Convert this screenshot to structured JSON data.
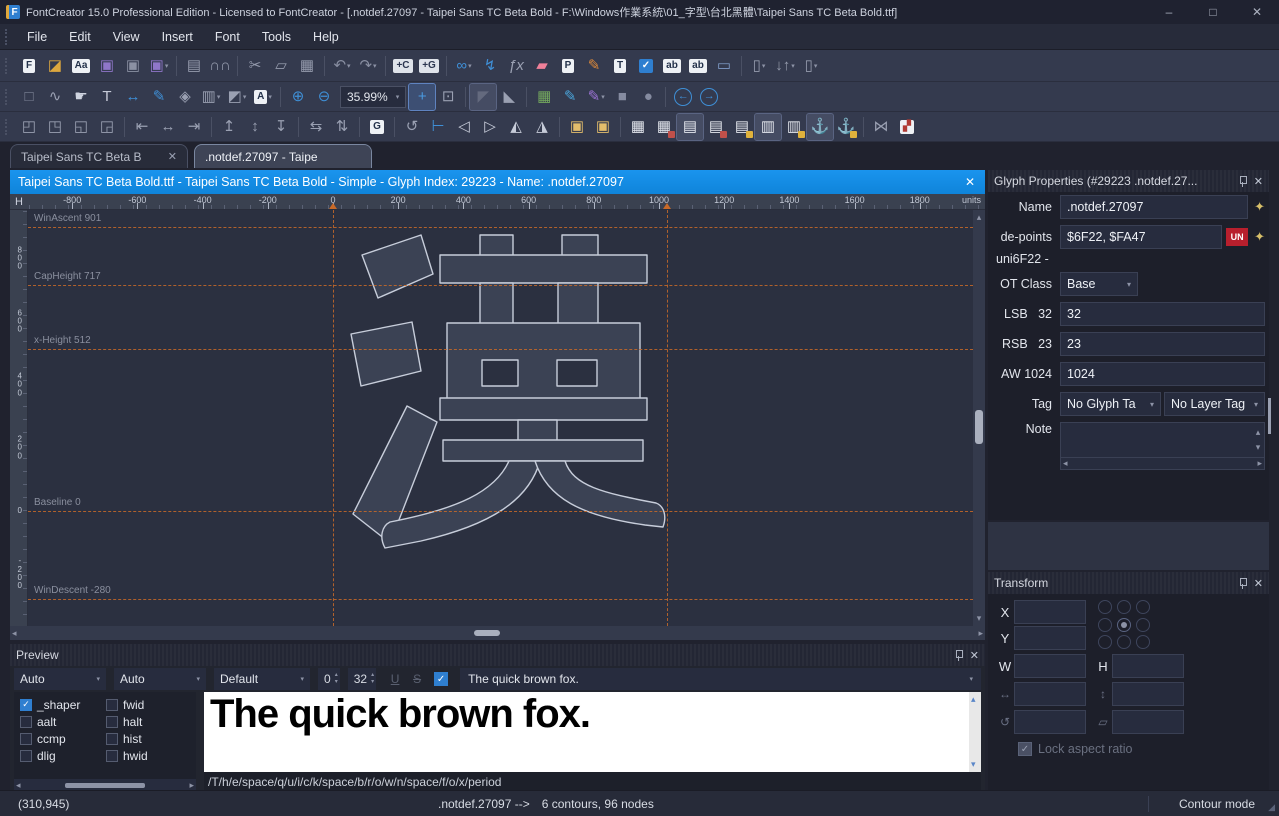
{
  "window": {
    "title": "FontCreator 15.0 Professional Edition - Licensed to FontCreator - [.notdef.27097 - Taipei Sans TC Beta Bold - F:\\Windows作業系統\\01_字型\\台北黑體\\Taipei Sans TC Beta Bold.ttf]",
    "app_initial": "F",
    "minimize": "–",
    "maximize": "□",
    "close": "✕"
  },
  "menu": {
    "items": [
      "File",
      "Edit",
      "View",
      "Insert",
      "Font",
      "Tools",
      "Help"
    ]
  },
  "toolbars": {
    "rows": [
      [
        {
          "n": "new-font",
          "g": "F",
          "chip": "#eef1f5",
          "c": "#23314a"
        },
        {
          "n": "open-font",
          "g": "◪",
          "c": "#dca73e"
        },
        {
          "n": "font-overview",
          "g": "Aa",
          "chip": "#eef1f5",
          "c": "#23314a"
        },
        {
          "n": "save-font",
          "g": "▣",
          "c": "#8f76c9"
        },
        {
          "n": "save-all",
          "g": "▣",
          "c": "#8b91a3"
        },
        {
          "n": "save-as",
          "g": "▣",
          "c": "#8f76c9",
          "dd": true
        },
        {
          "n": "print",
          "g": "▤",
          "c": "#959bad",
          "sep": true
        },
        {
          "n": "find",
          "g": "∩∩",
          "c": "#959bad"
        },
        {
          "n": "cut",
          "g": "✂",
          "c": "#959bad",
          "sep": true
        },
        {
          "n": "copy",
          "g": "▱",
          "c": "#959bad"
        },
        {
          "n": "paste",
          "g": "▦",
          "c": "#959bad"
        },
        {
          "n": "undo",
          "g": "↶",
          "c": "#878da0",
          "sep": true,
          "dd": true
        },
        {
          "n": "redo",
          "g": "↷",
          "c": "#878da0",
          "dd": true
        },
        {
          "n": "add-character",
          "g": "+C",
          "chip": "#dfe3ea",
          "c": "#2c3650",
          "sep": true
        },
        {
          "n": "add-glyph",
          "g": "+G",
          "chip": "#dfe3ea",
          "c": "#2c3650"
        },
        {
          "n": "insert-link",
          "g": "∞",
          "c": "#3f8fd6",
          "sep": true,
          "dd": true
        },
        {
          "n": "remove-link",
          "g": "↯",
          "c": "#3f8fd6"
        },
        {
          "n": "function",
          "g": "ƒx",
          "c": "#9aa0b2",
          "it": true
        },
        {
          "n": "eraser",
          "g": "▰",
          "c": "#ef8099"
        },
        {
          "n": "font-properties",
          "g": "P",
          "chip": "#eef1f5",
          "c": "#23314a"
        },
        {
          "n": "edit-metrics",
          "g": "✎",
          "c": "#df8a3a"
        },
        {
          "n": "auto-metrics",
          "g": "T",
          "chip": "#eef1f5",
          "c": "#23314a"
        },
        {
          "n": "validate",
          "g": "✓",
          "chip": "#2f7fd0",
          "c": "#ffffff"
        },
        {
          "n": "find-text",
          "g": "ab",
          "chip": "#eef1f5",
          "c": "#23314a"
        },
        {
          "n": "web-test",
          "g": "ab",
          "chip": "#eef1f5",
          "c": "#23314a"
        },
        {
          "n": "quick-test",
          "g": "▭",
          "c": "#7f9bc8"
        },
        {
          "n": "new-window",
          "g": "▯",
          "c": "#959bad",
          "sep": true,
          "dd": true
        },
        {
          "n": "sort-glyphs",
          "g": "↓↑",
          "c": "#959bad",
          "dd": true
        },
        {
          "n": "import-glyphs",
          "g": "▯",
          "c": "#959bad",
          "dd": true
        }
      ],
      [
        {
          "n": "select-tool",
          "g": "□",
          "c": "#7e8498"
        },
        {
          "n": "contour-select-tool",
          "g": "∿",
          "c": "#9aa0b2"
        },
        {
          "n": "hand-tool",
          "g": "☛",
          "c": "#cfd4e0"
        },
        {
          "n": "text-tool",
          "g": "T",
          "c": "#c6cbd8"
        },
        {
          "n": "measure-tool",
          "g": "↔",
          "c": "#3f8fd6"
        },
        {
          "n": "draw-tool",
          "g": "✎",
          "c": "#3f8fd6"
        },
        {
          "n": "knife-tool",
          "g": "◈",
          "c": "#9aa0b2"
        },
        {
          "n": "background-image",
          "g": "▥",
          "c": "#9aa0b2",
          "dd": true
        },
        {
          "n": "fill-mode",
          "g": "◩",
          "c": "#9aa0b2",
          "dd": true
        },
        {
          "n": "highlight-mode",
          "g": "A",
          "chip": "#eef1f5",
          "c": "#23314a",
          "dd": true
        },
        {
          "n": "zoom-in",
          "g": "⊕",
          "c": "#3f8fd6",
          "sep": true
        },
        {
          "n": "zoom-out",
          "g": "⊖",
          "c": "#3f8fd6"
        },
        {
          "type": "combo",
          "n": "zoom-level",
          "v": "35.99%"
        },
        {
          "n": "pan-tool",
          "g": "+",
          "c": "#4a9ae0",
          "act": true
        },
        {
          "n": "zoom-window",
          "g": "⊡",
          "c": "#9aa0b2"
        },
        {
          "n": "fill-preview",
          "g": "◤",
          "c": "#646a7e",
          "press": true,
          "sep": true
        },
        {
          "n": "node-edit",
          "g": "◣",
          "c": "#9aa0b2"
        },
        {
          "n": "insert-image",
          "g": "▦",
          "c": "#74a85e",
          "sep": true
        },
        {
          "n": "brush-tool",
          "g": "✎",
          "c": "#4aa3d9"
        },
        {
          "n": "calligraphy-tool",
          "g": "✎",
          "c": "#9d74d6",
          "dd": true
        },
        {
          "n": "rectangle-tool",
          "g": "■",
          "c": "#858ba0"
        },
        {
          "n": "ellipse-tool",
          "g": "●",
          "c": "#858ba0"
        },
        {
          "n": "nav-back",
          "g": "←",
          "c": "#3f8fd6",
          "ring": true,
          "sep": true
        },
        {
          "n": "nav-forward",
          "g": "→",
          "c": "#3f8fd6",
          "ring": true
        }
      ],
      [
        {
          "n": "align-left",
          "g": "◰",
          "c": "#9aa0b2"
        },
        {
          "n": "align-center-horizontal",
          "g": "◳",
          "c": "#9aa0b2"
        },
        {
          "n": "align-right",
          "g": "◱",
          "c": "#9aa0b2"
        },
        {
          "n": "align-points",
          "g": "◲",
          "c": "#9aa0b2"
        },
        {
          "n": "distribute-left",
          "g": "⇤",
          "c": "#9aa0b2",
          "sep": true
        },
        {
          "n": "distribute-center",
          "g": "↔",
          "c": "#9aa0b2"
        },
        {
          "n": "distribute-right",
          "g": "⇥",
          "c": "#9aa0b2"
        },
        {
          "n": "align-top",
          "g": "↥",
          "c": "#9aa0b2",
          "sep": true
        },
        {
          "n": "align-middle",
          "g": "↕",
          "c": "#9aa0b2"
        },
        {
          "n": "align-bottom",
          "g": "↧",
          "c": "#9aa0b2"
        },
        {
          "n": "center-horizontal",
          "g": "⇆",
          "c": "#9aa0b2",
          "sep": true
        },
        {
          "n": "center-vertical",
          "g": "⇅",
          "c": "#9aa0b2"
        },
        {
          "n": "glyph-metrics-link",
          "g": "G",
          "chip": "#eef1f5",
          "c": "#23314a",
          "sep": true
        },
        {
          "n": "free-rotate",
          "g": "↺",
          "c": "#9aa0b2",
          "sep": true
        },
        {
          "n": "slant-tool",
          "g": "⊢",
          "c": "#3f8fd6"
        },
        {
          "n": "flip-horizontal",
          "g": "◁",
          "c": "#c6cbd8"
        },
        {
          "n": "flip-vertical",
          "g": "▷",
          "c": "#c6cbd8"
        },
        {
          "n": "rotate-ccw",
          "g": "◭",
          "c": "#c6cbd8"
        },
        {
          "n": "rotate-cw",
          "g": "◮",
          "c": "#c6cbd8"
        },
        {
          "n": "order-forward",
          "g": "▣",
          "c": "#e3bd6b",
          "sep": true
        },
        {
          "n": "order-backward",
          "g": "▣",
          "c": "#e3bd6b"
        },
        {
          "n": "grid-all",
          "g": "▦",
          "c": "#e4e7ee",
          "sep": true
        },
        {
          "n": "grid-reset",
          "g": "▦",
          "c": "#e4e7ee",
          "badge": "#c0504a"
        },
        {
          "n": "grid-rows",
          "g": "▤",
          "c": "#e4e7ee",
          "press": true
        },
        {
          "n": "grid-rows-reset",
          "g": "▤",
          "c": "#e4e7ee",
          "badge": "#c0504a"
        },
        {
          "n": "grid-lock-rows",
          "g": "▤",
          "c": "#e4e7ee",
          "badge": "#e0b23c"
        },
        {
          "n": "grid-columns",
          "g": "▥",
          "c": "#e4e7ee",
          "press": true
        },
        {
          "n": "grid-lock-columns",
          "g": "▥",
          "c": "#e4e7ee",
          "badge": "#e0b23c"
        },
        {
          "n": "anchor",
          "g": "⚓",
          "c": "#4a9ae0",
          "press": true
        },
        {
          "n": "anchor-lock",
          "g": "⚓",
          "c": "#4a9ae0",
          "badge": "#e0b23c"
        },
        {
          "n": "composite-relations",
          "g": "⋈",
          "c": "#9aa0b2",
          "sep": true
        },
        {
          "n": "composite-data",
          "g": "▞",
          "chip": "#eef1f5",
          "c": "#b03a34"
        }
      ]
    ]
  },
  "tabs": [
    {
      "label": "Taipei Sans TC Beta B",
      "active": false
    },
    {
      "label": ".notdef.27097 - Taipe",
      "active": true
    }
  ],
  "editor": {
    "header": {
      "title": "Taipei Sans TC Beta Bold.ttf - Taipei Sans TC Beta Bold - Simple - Glyph Index: 29223 - Name: .notdef.27097",
      "close": "✕"
    },
    "ruler": {
      "h_label": "H",
      "units_label": "units",
      "top_ticks": [
        {
          "t": "-800",
          "u": -800
        },
        {
          "t": "-600",
          "u": -600
        },
        {
          "t": "-400",
          "u": -400
        },
        {
          "t": "-200",
          "u": -200
        },
        {
          "t": "0",
          "u": 0
        },
        {
          "t": "200",
          "u": 200
        },
        {
          "t": "400",
          "u": 400
        },
        {
          "t": "600",
          "u": 600
        },
        {
          "t": "800",
          "u": 800
        },
        {
          "t": "1000",
          "u": 1000
        },
        {
          "t": "1200",
          "u": 1200
        },
        {
          "t": "1400",
          "u": 1400
        },
        {
          "t": "1600",
          "u": 1600
        },
        {
          "t": "1800",
          "u": 1800
        }
      ],
      "markers": [
        0,
        1024
      ],
      "v_ticks": [
        {
          "t": "800",
          "u": 800
        },
        {
          "t": "600",
          "u": 600
        },
        {
          "t": "400",
          "u": 400
        },
        {
          "t": "200",
          "u": 200
        },
        {
          "t": "0",
          "u": 0
        },
        {
          "t": "-200",
          "u": -200
        }
      ]
    },
    "guides": [
      {
        "label": "WinAscent 901",
        "u": 901
      },
      {
        "label": "CapHeight 717",
        "u": 717
      },
      {
        "label": "x-Height 512",
        "u": 512
      },
      {
        "label": "Baseline 0",
        "u": 0
      },
      {
        "label": "WinDescent -280",
        "u": -280
      }
    ],
    "v_guides": [
      0,
      1024
    ],
    "glyph_char": "漢"
  },
  "glyph_properties": {
    "title": "Glyph Properties (#29223 .notdef.27...",
    "name_label": "Name",
    "name_value": ".notdef.27097",
    "codepoints_label": "de-points",
    "codepoints_value": "$6F22, $FA47",
    "unicode_badge": "UN",
    "unicode_info": "uni6F22 -",
    "ot_class_label": "OT Class",
    "ot_class_value": "Base",
    "lsb_label": "LSB",
    "lsb_static": "32",
    "lsb_value": "32",
    "rsb_label": "RSB",
    "rsb_static": "23",
    "rsb_value": "23",
    "aw_label": "AW",
    "aw_static": "1024",
    "aw_value": "1024",
    "tag_label": "Tag",
    "glyph_tag_value": "No Glyph Ta",
    "layer_tag_value": "No Layer Tag",
    "note_label": "Note"
  },
  "transform": {
    "title": "Transform",
    "x_label": "X",
    "y_label": "Y",
    "w_label": "W",
    "h_label": "H",
    "lock_label": "Lock aspect ratio"
  },
  "preview": {
    "title": "Preview",
    "script_value": "Auto",
    "language_value": "Auto",
    "feature_set_value": "Default",
    "tracking_value": "0",
    "size_value": "32",
    "underline_label": "U",
    "strike_label": "S",
    "sample_text": "The quick brown fox.",
    "glyph_sequence": "/T/h/e/space/q/u/i/c/k/space/b/r/o/w/n/space/f/o/x/period",
    "features_col1": [
      {
        "label": "_shaper",
        "checked": true
      },
      {
        "label": "aalt",
        "checked": false
      },
      {
        "label": "ccmp",
        "checked": false
      },
      {
        "label": "dlig",
        "checked": false
      }
    ],
    "features_col2": [
      {
        "label": "fwid",
        "checked": false
      },
      {
        "label": "halt",
        "checked": false
      },
      {
        "label": "hist",
        "checked": false
      },
      {
        "label": "hwid",
        "checked": false
      }
    ]
  },
  "status": {
    "coordinates": "(310,945)",
    "glyph_ref": ".notdef.27097 -->",
    "detail": "6 contours, 96 nodes",
    "mode": "Contour mode"
  }
}
